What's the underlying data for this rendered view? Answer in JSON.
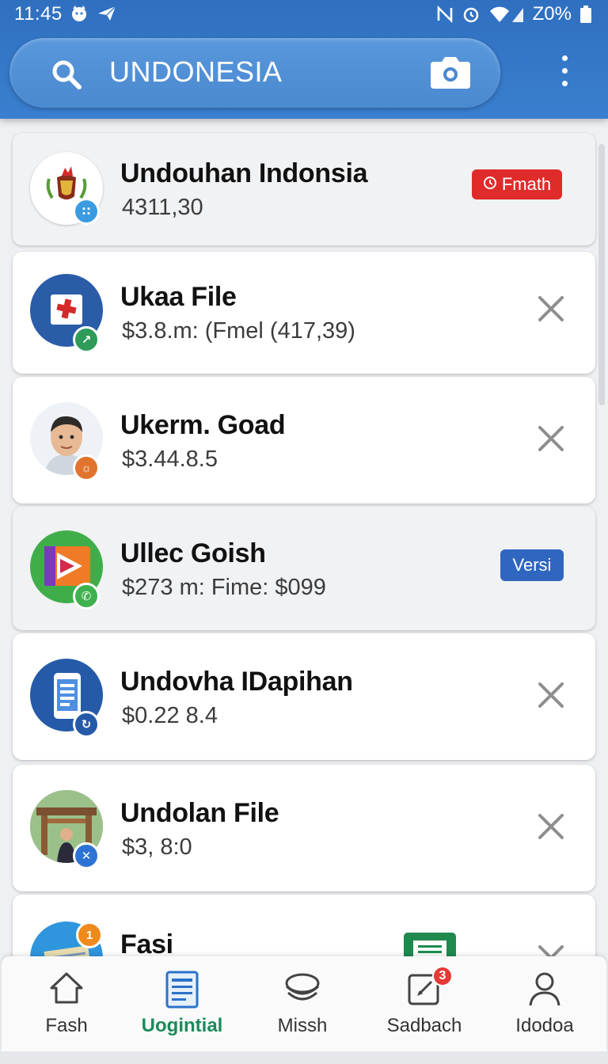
{
  "status_bar": {
    "time": "11:45",
    "battery_text": "Z0%"
  },
  "search": {
    "query": "UNDONESIA",
    "icons": [
      "search-icon",
      "camera-icon",
      "kebab-menu-icon"
    ]
  },
  "items": [
    {
      "title": "Undouhan Indonsia",
      "subtitle": "4311,30",
      "action": "pill",
      "pill_label": "Fmath",
      "pill_color": "#e02b2b",
      "avatar": "emblem",
      "badge_color": "#3b9be0"
    },
    {
      "title": "Ukaa File",
      "subtitle": "$3.8.m: (Fmel (417,39)",
      "action": "close",
      "avatar": "blue-card",
      "badge_color": "#2e9b58"
    },
    {
      "title": "Ukerm. Goad",
      "subtitle": "$3.44.8.5",
      "action": "close",
      "avatar": "person",
      "badge_color": "#e0742e"
    },
    {
      "title": "Ullec Goish",
      "subtitle": "$273 m: Fime: $099",
      "action": "pill",
      "pill_label": "Versi",
      "pill_color": "#2f66c0",
      "avatar": "play",
      "badge_color": "#3fb24f"
    },
    {
      "title": "Undovha IDapihan",
      "subtitle": "$0.22 8.4",
      "action": "close",
      "avatar": "phone",
      "badge_color": "#245aa8"
    },
    {
      "title": "Undolan File",
      "subtitle": "$3, 8:0",
      "action": "close",
      "avatar": "cabin",
      "badge_color": "#2d73d4"
    },
    {
      "title": "Fasi",
      "subtitle": "",
      "action": "close",
      "avatar": "map",
      "badge_color": "#f08a1d",
      "badge_text": "1"
    }
  ],
  "nav": [
    {
      "label": "Fash",
      "icon": "home-icon",
      "active": false
    },
    {
      "label": "Uogintial",
      "icon": "document-icon",
      "active": true
    },
    {
      "label": "Missh",
      "icon": "layers-icon",
      "active": false
    },
    {
      "label": "Sadbach",
      "icon": "edit-icon",
      "active": false,
      "notification": "3"
    },
    {
      "label": "Idodoa",
      "icon": "person-icon",
      "active": false
    }
  ],
  "colors": {
    "app_bar": "#3a7fcf",
    "active_tab": "#1d8a5a"
  }
}
